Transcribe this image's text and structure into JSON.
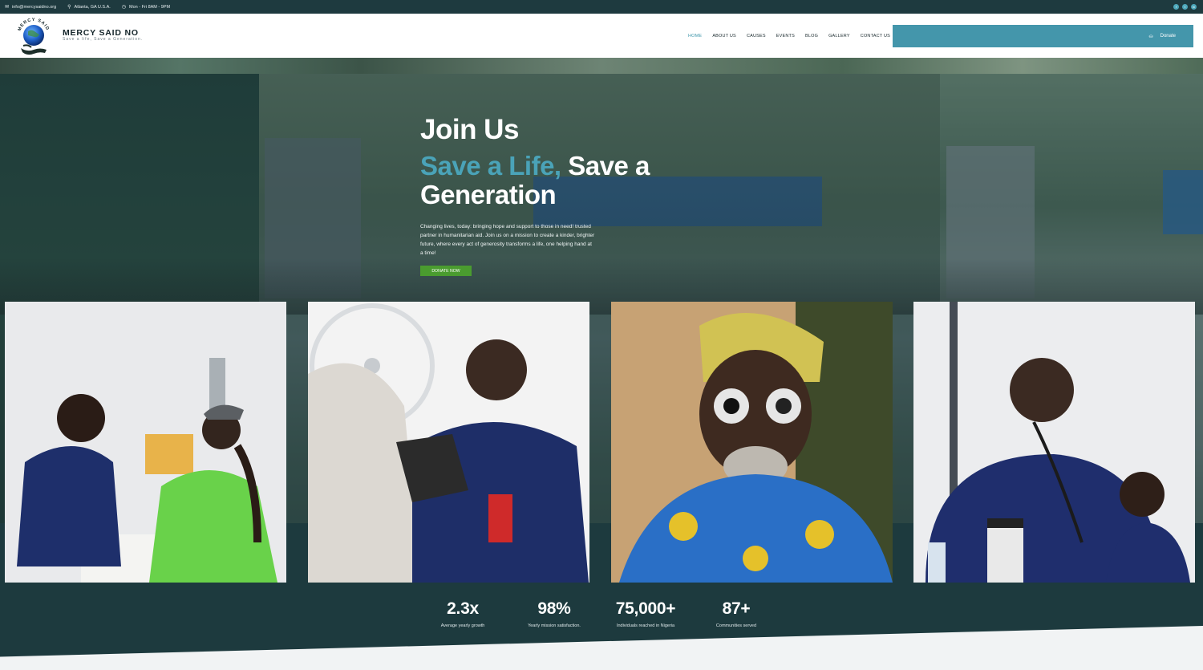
{
  "topbar": {
    "email": "info@mercysaidno.org",
    "location": "Atlanta, GA U.S.A.",
    "hours": "Mon - Fri 8AM - 9PM",
    "socials": [
      "facebook-icon",
      "twitter-icon",
      "linkedin-icon"
    ]
  },
  "brand": {
    "arc_text": "MERCY SAID NO",
    "name": "MERCY SAID NO",
    "tagline": "Save a life, Save a Generation."
  },
  "nav": {
    "items": [
      {
        "label": "HOME",
        "active": true
      },
      {
        "label": "ABOUT US",
        "active": false
      },
      {
        "label": "CAUSES",
        "active": false
      },
      {
        "label": "EVENTS",
        "active": false
      },
      {
        "label": "BLOG",
        "active": false
      },
      {
        "label": "GALLERY",
        "active": false
      },
      {
        "label": "CONTACT US",
        "active": false
      }
    ],
    "donate_label": "Donate"
  },
  "hero": {
    "title": "Join Us",
    "headline_accent": "Save a Life,",
    "headline_rest": " Save a Generation",
    "description": "Changing lives, today: bringing hope and support to those in need! trusted partner in humanitarian aid. Join us on a mission to create a kinder, brighter future, where every act of generosity transforms a life, one helping hand at a time!",
    "cta_label": "DONATE NOW"
  },
  "photos": [
    {
      "subject": "volunteer-checking-patient-photo"
    },
    {
      "subject": "blood-pressure-check-photo"
    },
    {
      "subject": "eye-exam-elder-photo"
    },
    {
      "subject": "child-stethoscope-photo"
    }
  ],
  "stats": [
    {
      "value": "2.3x",
      "label": "Average yearly growth"
    },
    {
      "value": "98%",
      "label": "Yearly mission satisfaction."
    },
    {
      "value": "75,000+",
      "label": "Individuals reached in Nigeria"
    },
    {
      "value": "87+",
      "label": "Communities served"
    }
  ],
  "colors": {
    "dark_teal": "#1e3a3f",
    "accent_teal": "#4496ab",
    "cta_green": "#4a9c2f",
    "white": "#ffffff"
  }
}
